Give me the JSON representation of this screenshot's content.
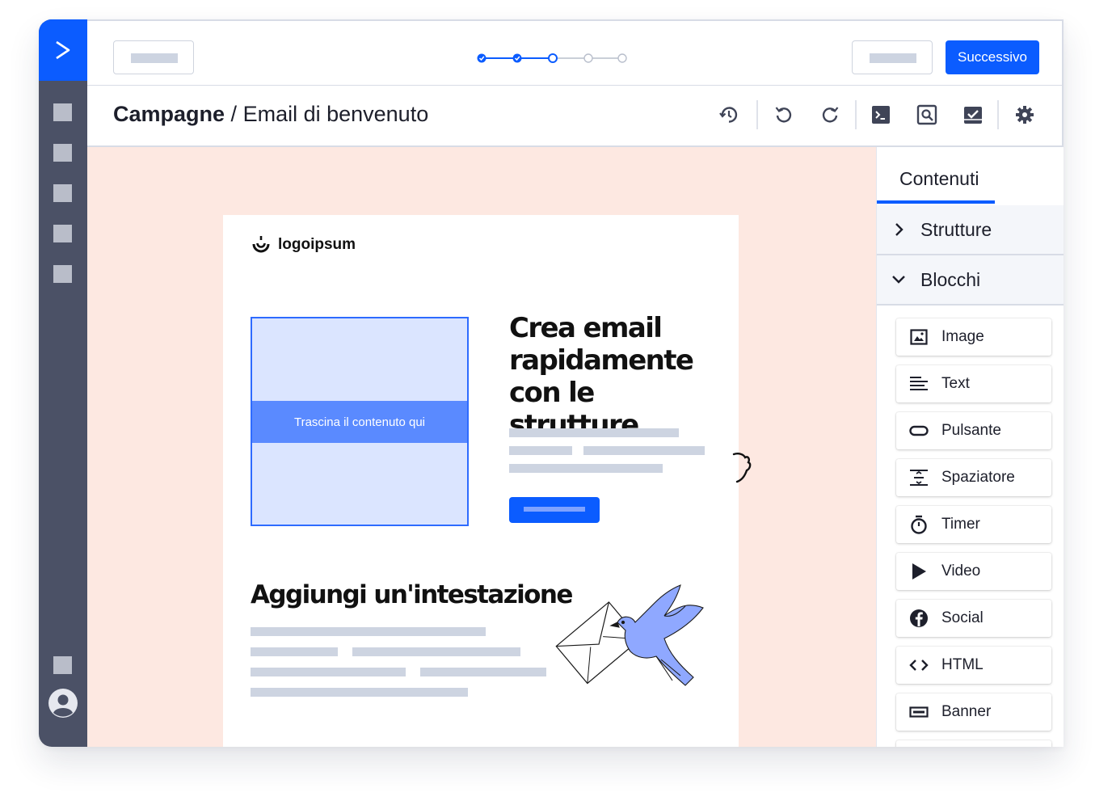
{
  "topbar": {
    "next_label": "Successivo",
    "steps": [
      {
        "state": "done"
      },
      {
        "state": "done"
      },
      {
        "state": "current"
      },
      {
        "state": "todo"
      },
      {
        "state": "todo"
      }
    ]
  },
  "breadcrumb": {
    "section": "Campagne",
    "separator": " / ",
    "page": "Email di benvenuto"
  },
  "toolbar": {
    "icons": [
      "history-icon",
      "undo-icon",
      "redo-icon",
      "code-icon",
      "preview-icon",
      "check-icon",
      "settings-icon"
    ]
  },
  "email": {
    "logo_text": "logoipsum",
    "dropzone_label": "Trascina il contenuto qui",
    "headline": "Crea email rapidamente con le strutture",
    "subheading": "Aggiungi un'intestazione"
  },
  "panel": {
    "tab_label": "Contenuti",
    "sections": [
      {
        "label": "Strutture",
        "expanded": false
      },
      {
        "label": "Blocchi",
        "expanded": true
      }
    ],
    "blocks": [
      {
        "label": "Image",
        "icon": "image-icon"
      },
      {
        "label": "Text",
        "icon": "text-icon"
      },
      {
        "label": "Pulsante",
        "icon": "button-icon"
      },
      {
        "label": "Spaziatore",
        "icon": "spacer-icon"
      },
      {
        "label": "Timer",
        "icon": "timer-icon"
      },
      {
        "label": "Video",
        "icon": "play-icon"
      },
      {
        "label": "Social",
        "icon": "facebook-icon"
      },
      {
        "label": "HTML",
        "icon": "code-icon"
      },
      {
        "label": "Banner",
        "icon": "banner-icon"
      }
    ]
  },
  "colors": {
    "brand": "#0b5cff",
    "rail": "#4b5166",
    "canvas": "#fde8e1",
    "dropzone": "#dbe5ff",
    "illustration": "#8fa8ff"
  }
}
